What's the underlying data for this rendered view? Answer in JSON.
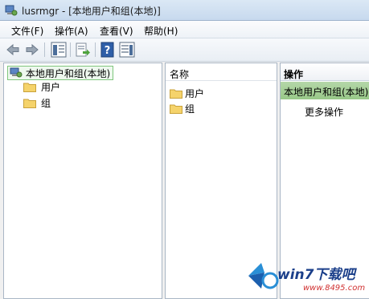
{
  "window": {
    "title": "lusrmgr - [本地用户和组(本地)]"
  },
  "menu": {
    "items": [
      {
        "label": "文件(F)"
      },
      {
        "label": "操作(A)"
      },
      {
        "label": "查看(V)"
      },
      {
        "label": "帮助(H)"
      }
    ]
  },
  "toolbar": {
    "buttons": [
      "back-arrow-icon",
      "forward-arrow-icon",
      "show-hide-tree-icon",
      "export-list-icon",
      "help-icon",
      "show-hide-action-pane-icon"
    ]
  },
  "tree": {
    "root_label": "本地用户和组(本地)",
    "children": [
      {
        "label": "用户"
      },
      {
        "label": "组"
      }
    ]
  },
  "list": {
    "column_header": "名称",
    "items": [
      {
        "label": "用户"
      },
      {
        "label": "组"
      }
    ]
  },
  "actions": {
    "header": "操作",
    "section_title": "本地用户和组(本地)",
    "more_actions": "更多操作"
  },
  "watermark": {
    "brand": "win7下载吧",
    "url": "www.8495.com"
  },
  "colors": {
    "folder": "#f5d36b",
    "selection_green": "#98c888"
  }
}
